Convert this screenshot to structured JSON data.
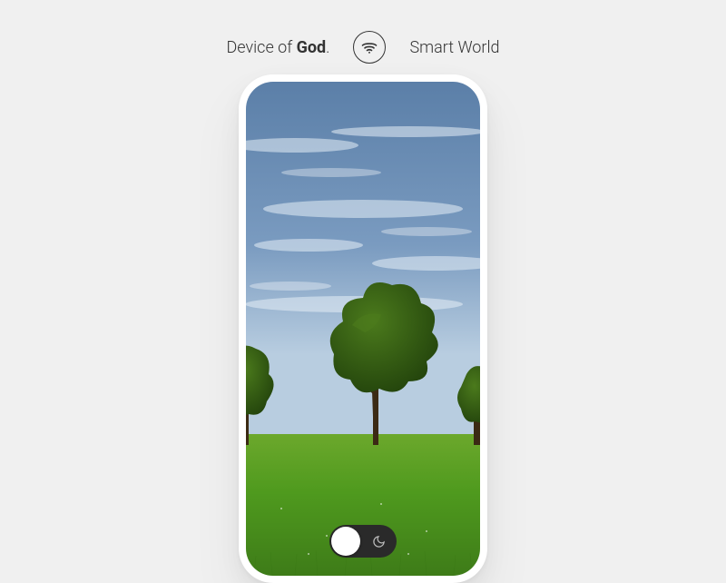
{
  "header": {
    "left_prefix": "Device of ",
    "left_bold": "God",
    "left_suffix": ".",
    "right": "Smart World"
  },
  "toggle": {
    "state": "day",
    "icon_name": "moon-icon"
  }
}
